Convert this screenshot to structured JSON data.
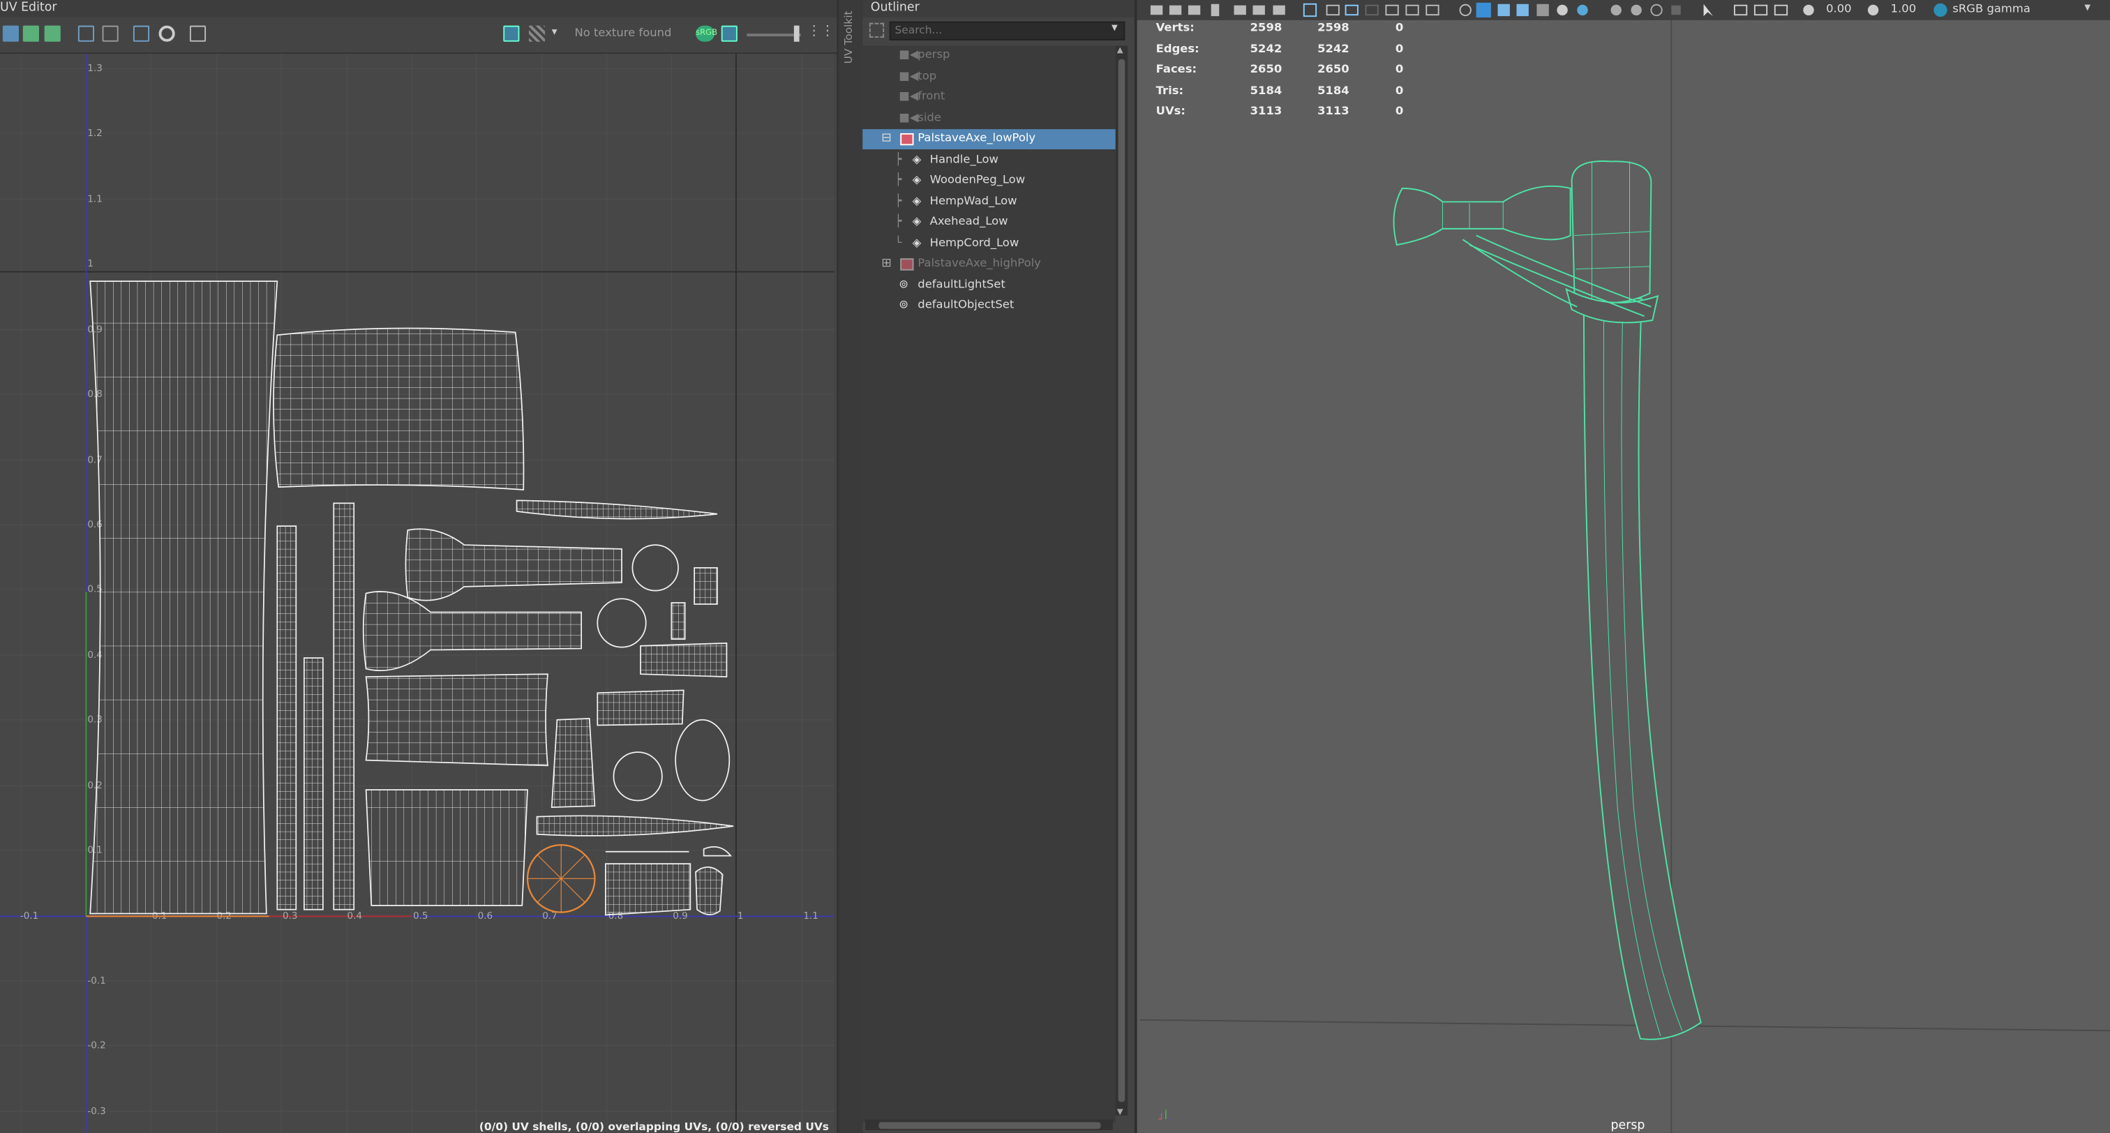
{
  "uv_editor": {
    "title": "UV Editor",
    "texture_status": "No texture found",
    "srgb_label": "sRGB",
    "status": "(0/0) UV shells, (0/0) overlapping UVs, (0/0) reversed UVs",
    "side_label": "UV Toolkit",
    "y_ticks": [
      "1.3",
      "1.2",
      "1.1",
      "1",
      "0.9",
      "0.8",
      "0.7",
      "0.6",
      "0.5",
      "0.4",
      "0.3",
      "0.2",
      "0.1",
      "-0.1",
      "-0.2",
      "-0.3"
    ],
    "x_ticks": [
      "-0.1",
      "0.1",
      "0.2",
      "0.3",
      "0.4",
      "0.5",
      "0.6",
      "0.7",
      "0.8",
      "0.9",
      "1",
      "1.1"
    ]
  },
  "outliner": {
    "title": "Outliner",
    "search_placeholder": "Search...",
    "items": [
      {
        "label": "persp",
        "type": "camera",
        "dim": true
      },
      {
        "label": "top",
        "type": "camera",
        "dim": true
      },
      {
        "label": "front",
        "type": "camera",
        "dim": true
      },
      {
        "label": "side",
        "type": "camera",
        "dim": true
      },
      {
        "label": "PalstaveAxe_lowPoly",
        "type": "group",
        "selected": true
      },
      {
        "label": "Handle_Low",
        "type": "mesh"
      },
      {
        "label": "WoodenPeg_Low",
        "type": "mesh"
      },
      {
        "label": "HempWad_Low",
        "type": "mesh"
      },
      {
        "label": "Axehead_Low",
        "type": "mesh"
      },
      {
        "label": "HempCord_Low",
        "type": "mesh"
      },
      {
        "label": "PalstaveAxe_highPoly",
        "type": "group",
        "dim": true
      },
      {
        "label": "defaultLightSet",
        "type": "set"
      },
      {
        "label": "defaultObjectSet",
        "type": "set"
      }
    ]
  },
  "viewport": {
    "exposure": "0.00",
    "gamma": "1.00",
    "color_space": "sRGB gamma",
    "camera": "persp",
    "hud": [
      {
        "label": "Verts:",
        "v1": "2598",
        "v2": "2598",
        "v3": "0"
      },
      {
        "label": "Edges:",
        "v1": "5242",
        "v2": "5242",
        "v3": "0"
      },
      {
        "label": "Faces:",
        "v1": "2650",
        "v2": "2650",
        "v3": "0"
      },
      {
        "label": "Tris:",
        "v1": "5184",
        "v2": "5184",
        "v3": "0"
      },
      {
        "label": "UVs:",
        "v1": "3113",
        "v2": "3113",
        "v3": "0"
      }
    ],
    "wire_color": "#4fe3a6"
  }
}
